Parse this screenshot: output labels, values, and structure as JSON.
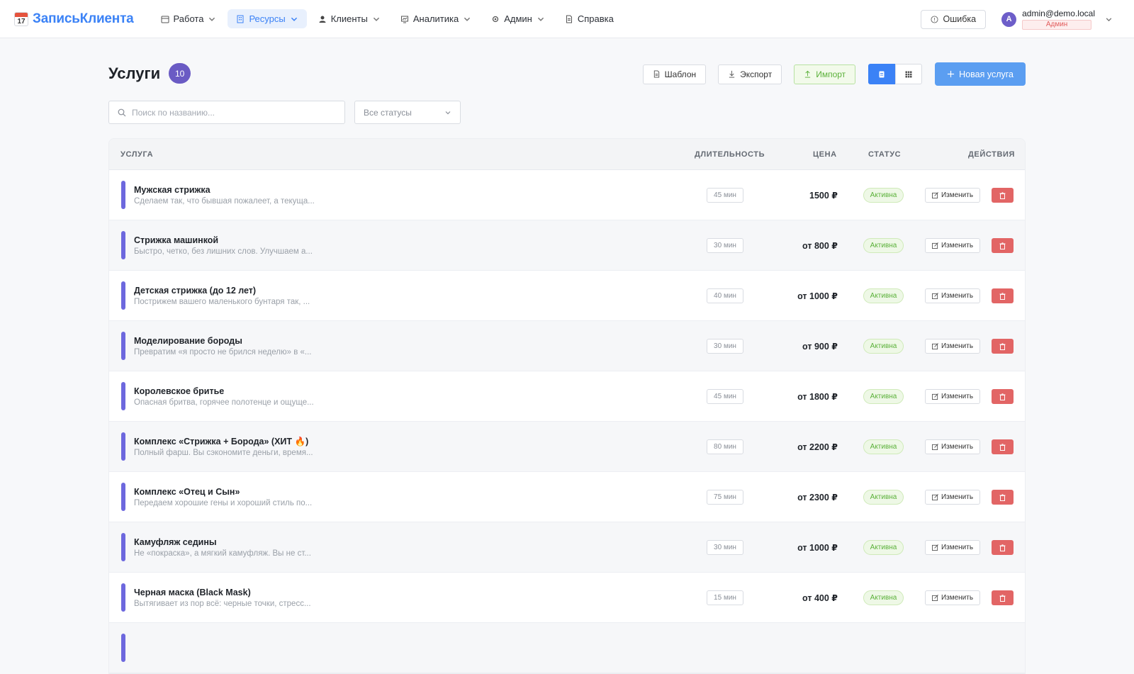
{
  "app": {
    "name": "ЗаписьКлиента",
    "logo_day": "17"
  },
  "nav": {
    "items": [
      {
        "label": "Работа",
        "icon": "calendar-icon"
      },
      {
        "label": "Ресурсы",
        "icon": "building-icon"
      },
      {
        "label": "Клиенты",
        "icon": "person-icon"
      },
      {
        "label": "Аналитика",
        "icon": "chart-icon"
      },
      {
        "label": "Админ",
        "icon": "gear-icon"
      },
      {
        "label": "Справка",
        "icon": "document-icon"
      }
    ],
    "active": "Ресурсы"
  },
  "header": {
    "error_button": "Ошибка",
    "user": {
      "avatar_letter": "A",
      "email": "admin@demo.local",
      "role": "Админ"
    }
  },
  "page": {
    "title": "Услуги",
    "count": "10",
    "toolbar": {
      "template": "Шаблон",
      "export": "Экспорт",
      "import": "Импорт",
      "new_service": "Новая услуга"
    }
  },
  "filters": {
    "search_placeholder": "Поиск по названию...",
    "status_select": "Все статусы"
  },
  "table": {
    "columns": {
      "service": "УСЛУГА",
      "duration": "ДЛИТЕЛЬНОСТЬ",
      "price": "ЦЕНА",
      "status": "СТАТУС",
      "actions": "ДЕЙСТВИЯ"
    },
    "edit_label": "Изменить",
    "rows": [
      {
        "name": "Мужская стрижка",
        "desc": "Сделаем так, что бывшая пожалеет, а текуща...",
        "duration": "45 мин",
        "price": "1500 ₽",
        "status": "Активна"
      },
      {
        "name": "Стрижка машинкой",
        "desc": "Быстро, четко, без лишних слов. Улучшаем а...",
        "duration": "30 мин",
        "price": "от 800 ₽",
        "status": "Активна"
      },
      {
        "name": "Детская стрижка (до 12 лет)",
        "desc": "Пострижем вашего маленького бунтаря так, ...",
        "duration": "40 мин",
        "price": "от 1000 ₽",
        "status": "Активна"
      },
      {
        "name": "Моделирование бороды",
        "desc": "Превратим «я просто не брился неделю» в «...",
        "duration": "30 мин",
        "price": "от 900 ₽",
        "status": "Активна"
      },
      {
        "name": "Королевское бритье",
        "desc": "Опасная бритва, горячее полотенце и ощуще...",
        "duration": "45 мин",
        "price": "от 1800 ₽",
        "status": "Активна"
      },
      {
        "name": "Комплекс «Стрижка + Борода» (ХИТ 🔥)",
        "desc": "Полный фарш. Вы сэкономите деньги, время...",
        "duration": "80 мин",
        "price": "от 2200 ₽",
        "status": "Активна"
      },
      {
        "name": "Комплекс «Отец и Сын»",
        "desc": "Передаем хорошие гены и хороший стиль по...",
        "duration": "75 мин",
        "price": "от 2300 ₽",
        "status": "Активна"
      },
      {
        "name": "Камуфляж седины",
        "desc": "Не «покраска», а мягкий камуфляж. Вы не ст...",
        "duration": "30 мин",
        "price": "от 1000 ₽",
        "status": "Активна"
      },
      {
        "name": "Черная маска (Black Mask)",
        "desc": "Вытягивает из пор всё: черные точки, стресс...",
        "duration": "15 мин",
        "price": "от 400 ₽",
        "status": "Активна"
      },
      {
        "name": "",
        "desc": "",
        "duration": "",
        "price": "",
        "status": ""
      }
    ]
  }
}
